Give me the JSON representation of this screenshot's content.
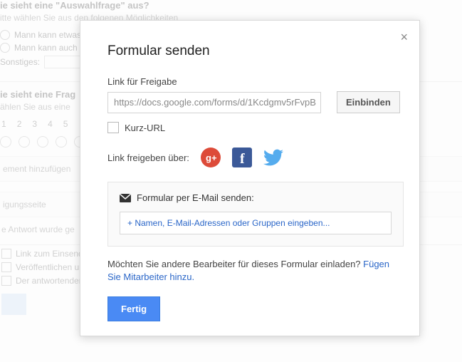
{
  "background": {
    "q1_title": "ie sieht eine \"Auswahlfrage\" aus?",
    "q1_help": "itte wählen Sie aus den folgenen Möglichkeiten",
    "q1_opt1": "Mann kann etwas",
    "q1_opt2": "Mann kann auch n",
    "q1_opt3": "Sonstiges:",
    "q2_title": "ie sieht eine Frag",
    "q2_help": "ählen Sie aus eine",
    "scale": [
      "1",
      "2",
      "3",
      "4",
      "5"
    ],
    "addElement": "ement hinzufügen",
    "confirmPage": "igungsseite",
    "confirmMsg": "e Antwort wurde ge",
    "chk1": "Link zum Einsenden einer weiteren Antwort anzeigen",
    "chk2": "Veröffentlichen und öffentlichen Link für die Ergebnisse des Formulars anzeigen",
    "chk3": "Der antwortenden Person ermöglichen, die Antwort nach Absenden zu bearbeiten"
  },
  "modal": {
    "title": "Formular senden",
    "linkLabel": "Link für Freigabe",
    "linkValue": "https://docs.google.com/forms/d/1Kcdgmv5rFvpB",
    "embedBtn": "Einbinden",
    "shortUrl": "Kurz-URL",
    "shareVia": "Link freigeben über:",
    "emailHeader": "Formular per E-Mail senden:",
    "emailPlaceholder": "+ Namen, E-Mail-Adressen oder Gruppen eingeben...",
    "inviteLead": "Möchten Sie andere Bearbeiter für dieses Formular einladen? ",
    "inviteLink": "Fügen Sie Mitarbeiter hinzu.",
    "done": "Fertig"
  },
  "icons": {
    "gplus": "google-plus-icon",
    "fb": "facebook-icon",
    "tw": "twitter-icon",
    "mail": "mail-icon",
    "close": "close-icon"
  }
}
